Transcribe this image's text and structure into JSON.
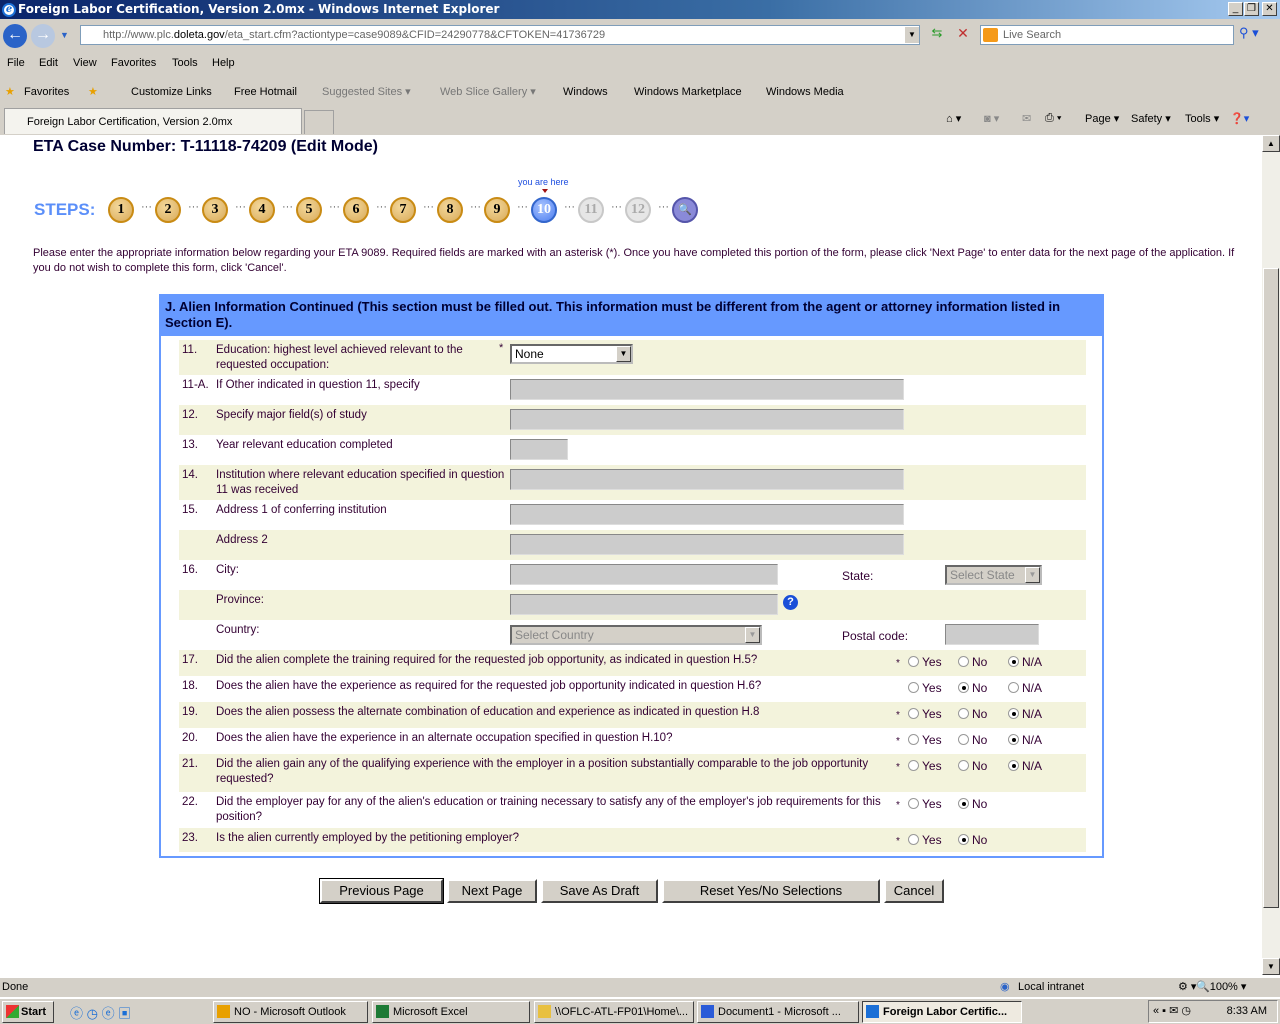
{
  "window": {
    "title": "Foreign Labor Certification, Version 2.0mx - Windows Internet Explorer"
  },
  "browser": {
    "url_prefix": "http://www.plc.",
    "url_domain": "doleta.gov",
    "url_suffix": "/eta_start.cfm?actiontype=case9089&CFID=24290778&CFTOKEN=41736729",
    "search_placeholder": "Live Search",
    "menu": [
      "File",
      "Edit",
      "View",
      "Favorites",
      "Tools",
      "Help"
    ],
    "favorites_label": "Favorites",
    "links": [
      "Customize Links",
      "Free Hotmail",
      "Suggested Sites",
      "Web Slice Gallery",
      "Windows",
      "Windows Marketplace",
      "Windows Media"
    ],
    "tab_title": "Foreign Labor Certification, Version 2.0mx",
    "commands": [
      "Page",
      "Safety",
      "Tools"
    ]
  },
  "page": {
    "case_number": "ETA Case Number: T-11118-74209  (Edit Mode)",
    "steps_label": "STEPS:",
    "you_are_here": "you are here",
    "steps": [
      "1",
      "2",
      "3",
      "4",
      "5",
      "6",
      "7",
      "8",
      "9",
      "10",
      "11",
      "12"
    ],
    "current_step": 10,
    "intro": "Please enter the appropriate information below regarding your ETA 9089. Required fields are marked with an asterisk (*). Once you have completed this portion of the form, please click 'Next Page' to enter data for the next page of the application. If you do not wish to complete this form, click 'Cancel'.",
    "section_title": "J. Alien Information Continued (This section must be filled out. This information must be different from the agent or    attorney information listed in Section E).",
    "fields": [
      {
        "num": "11.",
        "label": "Education: highest level achieved relevant to the requested occupation:",
        "required": true,
        "type": "select",
        "value": "None"
      },
      {
        "num": "11-A.",
        "label": "If Other indicated in question 11, specify",
        "type": "text"
      },
      {
        "num": "12.",
        "label": "Specify major field(s) of study",
        "type": "text"
      },
      {
        "num": "13.",
        "label": "Year relevant education completed",
        "type": "short"
      },
      {
        "num": "14.",
        "label": "Institution where relevant education specified in question 11 was received",
        "type": "text"
      },
      {
        "num": "15.",
        "label": "Address 1 of conferring institution",
        "type": "text"
      },
      {
        "num": "",
        "label": "Address 2",
        "type": "text"
      },
      {
        "num": "16.",
        "label": "City:",
        "type": "city",
        "side_label": "State:",
        "side_value": "Select State"
      },
      {
        "num": "",
        "label": "Province:",
        "type": "province"
      },
      {
        "num": "",
        "label": "Country:",
        "type": "country",
        "value": "Select Country",
        "side_label": "Postal code:"
      }
    ],
    "questions": [
      {
        "num": "17.",
        "label": "Did the alien complete the training required for the requested job opportunity, as indicated in question H.5?",
        "required": true,
        "options": [
          "Yes",
          "No",
          "N/A"
        ],
        "selected": "N/A"
      },
      {
        "num": "18.",
        "label": "Does the alien have the experience as required for the requested job opportunity indicated in question H.6?",
        "required": false,
        "options": [
          "Yes",
          "No",
          "N/A"
        ],
        "selected": "No"
      },
      {
        "num": "19.",
        "label": "Does the alien possess the alternate combination of education and experience as indicated in question H.8",
        "required": true,
        "options": [
          "Yes",
          "No",
          "N/A"
        ],
        "selected": "N/A"
      },
      {
        "num": "20.",
        "label": "Does the alien have the experience in an alternate occupation specified in question H.10?",
        "required": true,
        "options": [
          "Yes",
          "No",
          "N/A"
        ],
        "selected": "N/A"
      },
      {
        "num": "21.",
        "label": "Did the alien gain any of the qualifying experience with the employer in a position substantially comparable to the job opportunity requested?",
        "required": true,
        "options": [
          "Yes",
          "No",
          "N/A"
        ],
        "selected": "N/A"
      },
      {
        "num": "22.",
        "label": "Did the employer pay for any of the alien's education or training necessary to satisfy any of the employer's job requirements for this position?",
        "required": true,
        "options": [
          "Yes",
          "No"
        ],
        "selected": "No"
      },
      {
        "num": "23.",
        "label": "Is the alien currently employed by the petitioning employer?",
        "required": true,
        "options": [
          "Yes",
          "No"
        ],
        "selected": "No"
      }
    ],
    "buttons": [
      "Previous Page",
      "Next Page",
      "Save As Draft",
      "Reset Yes/No Selections",
      "Cancel"
    ]
  },
  "status": {
    "text": "Done",
    "zone": "Local intranet",
    "zoom": "100%"
  },
  "taskbar": {
    "start": "Start",
    "tasks": [
      "NO - Microsoft Outlook",
      "Microsoft Excel",
      "\\\\OFLC-ATL-FP01\\Home\\...",
      "Document1 - Microsoft ...",
      "Foreign Labor Certific..."
    ],
    "clock": "8:33 AM"
  },
  "colors": {
    "accent": "#6699ff",
    "row_shade": "#f3f3dc",
    "text": "#330033"
  }
}
